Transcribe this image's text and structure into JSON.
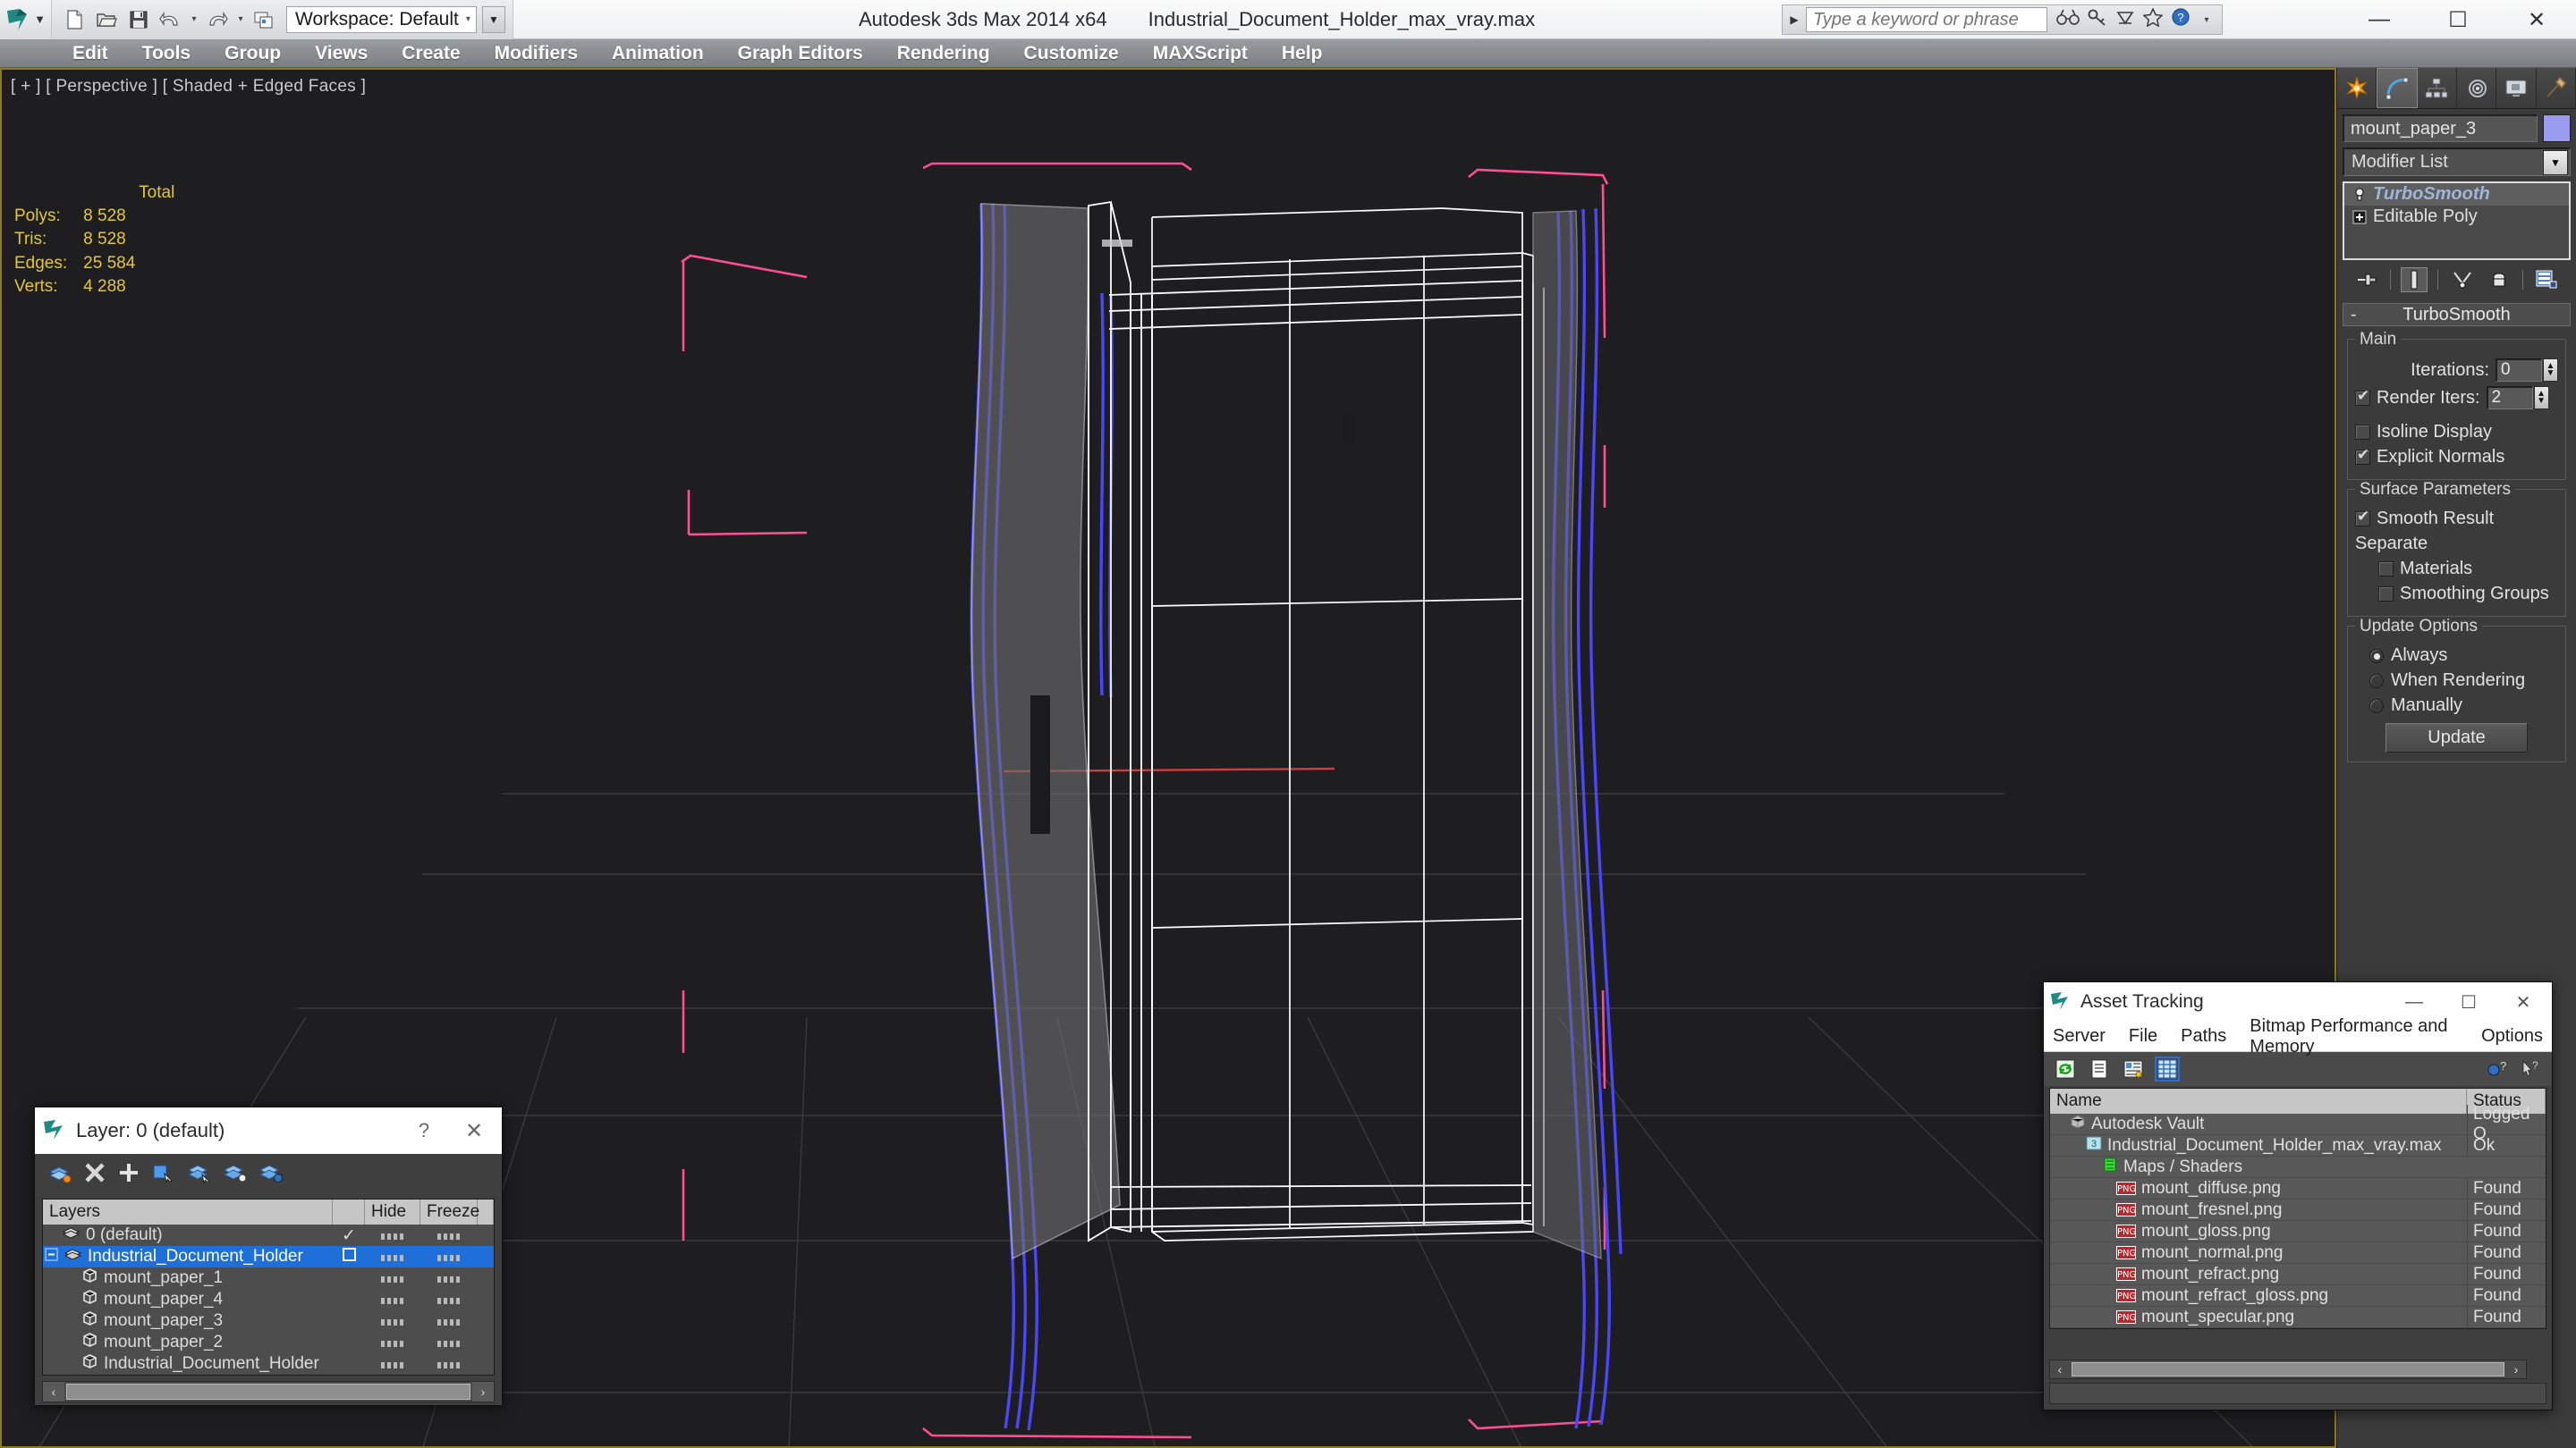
{
  "titlebar": {
    "workspace": "Workspace: Default",
    "app_title": "Autodesk 3ds Max  2014 x64",
    "file_title": "Industrial_Document_Holder_max_vray.max",
    "search_placeholder": "Type a keyword or phrase",
    "minimize": "—",
    "maximize": "☐",
    "close": "✕",
    "qat": [
      "new-icon",
      "open-icon",
      "save-icon",
      "undo-icon",
      "redo-icon",
      "set-project-folder-icon"
    ],
    "search_icons": [
      "binoculars-icon",
      "key-icon",
      "satellite-icon",
      "star-icon",
      "help-icon"
    ]
  },
  "menubar": {
    "items": [
      "Edit",
      "Tools",
      "Group",
      "Views",
      "Create",
      "Modifiers",
      "Animation",
      "Graph Editors",
      "Rendering",
      "Customize",
      "MAXScript",
      "Help"
    ]
  },
  "viewport": {
    "label": "[ + ] [ Perspective ] [ Shaded + Edged Faces ]",
    "stats": {
      "header": "Total",
      "rows": [
        {
          "label": "Polys:",
          "value": "8 528"
        },
        {
          "label": "Tris:",
          "value": "8 528"
        },
        {
          "label": "Edges:",
          "value": "25 584"
        },
        {
          "label": "Verts:",
          "value": "4 288"
        }
      ]
    },
    "colors": {
      "gizmo_pink": "#ff4d94",
      "selection_blue": "#4a46ff",
      "wire_white": "#ffffff",
      "grid": "#3a3a3c",
      "axis_red": "#d33a3a",
      "background": "#1e1e20"
    }
  },
  "command_panel": {
    "tabs": [
      "create-tab",
      "modify-tab",
      "hierarchy-tab",
      "motion-tab",
      "display-tab",
      "utilities-tab"
    ],
    "active_tab": "modify-tab",
    "object_name": "mount_paper_3",
    "object_color": "#9a9cf0",
    "modifier_list_label": "Modifier List",
    "stack": [
      {
        "label": "TurboSmooth",
        "icon": "lightbulb-icon",
        "selected": true
      },
      {
        "label": "Editable Poly",
        "icon": "plus-box-icon",
        "selected": false
      }
    ],
    "stack_buttons": [
      "pin-stack-icon",
      "show-end-result-icon",
      "make-unique-icon",
      "remove-modifier-icon",
      "configure-modifier-sets-icon"
    ],
    "rollout": {
      "title": "TurboSmooth",
      "collapse_glyph": "-",
      "groups": [
        {
          "title": "Main",
          "controls": [
            {
              "type": "spinner",
              "label": "Iterations:",
              "value": "0",
              "checkbox": null
            },
            {
              "type": "spinner",
              "label": "Render Iters:",
              "value": "2",
              "checkbox": true
            },
            {
              "type": "checkbox",
              "label": "Isoline Display",
              "checked": false
            },
            {
              "type": "checkbox",
              "label": "Explicit Normals",
              "checked": true
            }
          ]
        },
        {
          "title": "Surface Parameters",
          "controls": [
            {
              "type": "checkbox",
              "label": "Smooth Result",
              "checked": true
            },
            {
              "type": "text",
              "label": "Separate"
            },
            {
              "type": "checkbox",
              "label": "Materials",
              "checked": false,
              "indent": true
            },
            {
              "type": "checkbox",
              "label": "Smoothing Groups",
              "checked": false,
              "indent": true
            }
          ]
        },
        {
          "title": "Update Options",
          "controls": [
            {
              "type": "radio",
              "label": "Always",
              "checked": true
            },
            {
              "type": "radio",
              "label": "When Rendering",
              "checked": false
            },
            {
              "type": "radio",
              "label": "Manually",
              "checked": false
            },
            {
              "type": "button",
              "label": "Update"
            }
          ]
        }
      ]
    }
  },
  "layer_dialog": {
    "title": "Layer: 0 (default)",
    "help_glyph": "?",
    "close_glyph": "✕",
    "toolbar_icons": [
      "new-layer-icon",
      "delete-layer-icon",
      "add-selection-icon",
      "select-objects-icon",
      "select-highlighted-icon",
      "highlight-selected-icon",
      "layer-properties-icon"
    ],
    "columns": [
      "Layers",
      "",
      "Hide",
      "Freeze"
    ],
    "rows": [
      {
        "name": "0 (default)",
        "icon": "layer-icon",
        "indent": 1,
        "current": true,
        "selected": false,
        "expander": ""
      },
      {
        "name": "Industrial_Document_Holder",
        "icon": "layer-icon",
        "indent": 0,
        "current": false,
        "selected": true,
        "expander": "-"
      },
      {
        "name": "mount_paper_1",
        "icon": "object-icon",
        "indent": 2,
        "current": false,
        "selected": false,
        "expander": ""
      },
      {
        "name": "mount_paper_4",
        "icon": "object-icon",
        "indent": 2,
        "current": false,
        "selected": false,
        "expander": ""
      },
      {
        "name": "mount_paper_3",
        "icon": "object-icon",
        "indent": 2,
        "current": false,
        "selected": false,
        "expander": ""
      },
      {
        "name": "mount_paper_2",
        "icon": "object-icon",
        "indent": 2,
        "current": false,
        "selected": false,
        "expander": ""
      },
      {
        "name": "Industrial_Document_Holder",
        "icon": "object-icon",
        "indent": 2,
        "current": false,
        "selected": false,
        "expander": ""
      }
    ],
    "scroll_left": "‹",
    "scroll_right": "›"
  },
  "asset_dialog": {
    "title": "Asset Tracking",
    "minimize": "—",
    "maximize": "☐",
    "close": "✕",
    "menu": [
      "Server",
      "File",
      "Paths",
      "Bitmap Performance and Memory",
      "Options"
    ],
    "toolbar_icons": [
      "refresh-icon",
      "list-view-icon",
      "details-view-icon",
      "grid-view-icon"
    ],
    "toolbar_right_icons": [
      "help-new-icon",
      "help-pick-icon"
    ],
    "columns": [
      "Name",
      "Status"
    ],
    "rows": [
      {
        "name": "Autodesk Vault",
        "status": "Logged O",
        "icon": "vault-icon",
        "indent": 1
      },
      {
        "name": "Industrial_Document_Holder_max_vray.max",
        "status": "Ok",
        "icon": "max-file-icon",
        "indent": 2
      },
      {
        "name": "Maps / Shaders",
        "status": "",
        "icon": "maps-icon",
        "indent": 3
      },
      {
        "name": "mount_diffuse.png",
        "status": "Found",
        "icon": "png-icon",
        "indent": 4
      },
      {
        "name": "mount_fresnel.png",
        "status": "Found",
        "icon": "png-icon",
        "indent": 4
      },
      {
        "name": "mount_gloss.png",
        "status": "Found",
        "icon": "png-icon",
        "indent": 4
      },
      {
        "name": "mount_normal.png",
        "status": "Found",
        "icon": "png-icon",
        "indent": 4
      },
      {
        "name": "mount_refract.png",
        "status": "Found",
        "icon": "png-icon",
        "indent": 4
      },
      {
        "name": "mount_refract_gloss.png",
        "status": "Found",
        "icon": "png-icon",
        "indent": 4
      },
      {
        "name": "mount_specular.png",
        "status": "Found",
        "icon": "png-icon",
        "indent": 4
      }
    ],
    "png_badge": "PNG"
  }
}
